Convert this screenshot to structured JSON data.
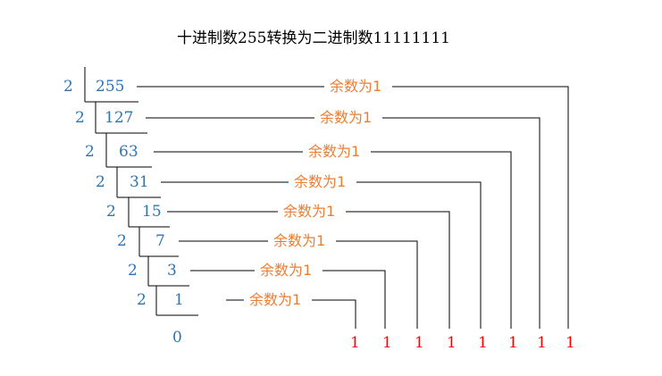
{
  "title": "十进制数255转换为二进制数11111111",
  "divisor": "2",
  "remainder_label": "余数为1",
  "colors": {
    "divisor": "#2e74b5",
    "quotient": "#2e74b5",
    "remainder_label": "#ed7d31",
    "bit": "#ff0000",
    "line": "#000000",
    "title": "#000000"
  },
  "steps": [
    {
      "quotient": "255"
    },
    {
      "quotient": "127"
    },
    {
      "quotient": "63"
    },
    {
      "quotient": "31"
    },
    {
      "quotient": "15"
    },
    {
      "quotient": "7"
    },
    {
      "quotient": "3"
    },
    {
      "quotient": "1"
    }
  ],
  "final_quotient": "0",
  "bits": [
    "1",
    "1",
    "1",
    "1",
    "1",
    "1",
    "1",
    "1"
  ]
}
